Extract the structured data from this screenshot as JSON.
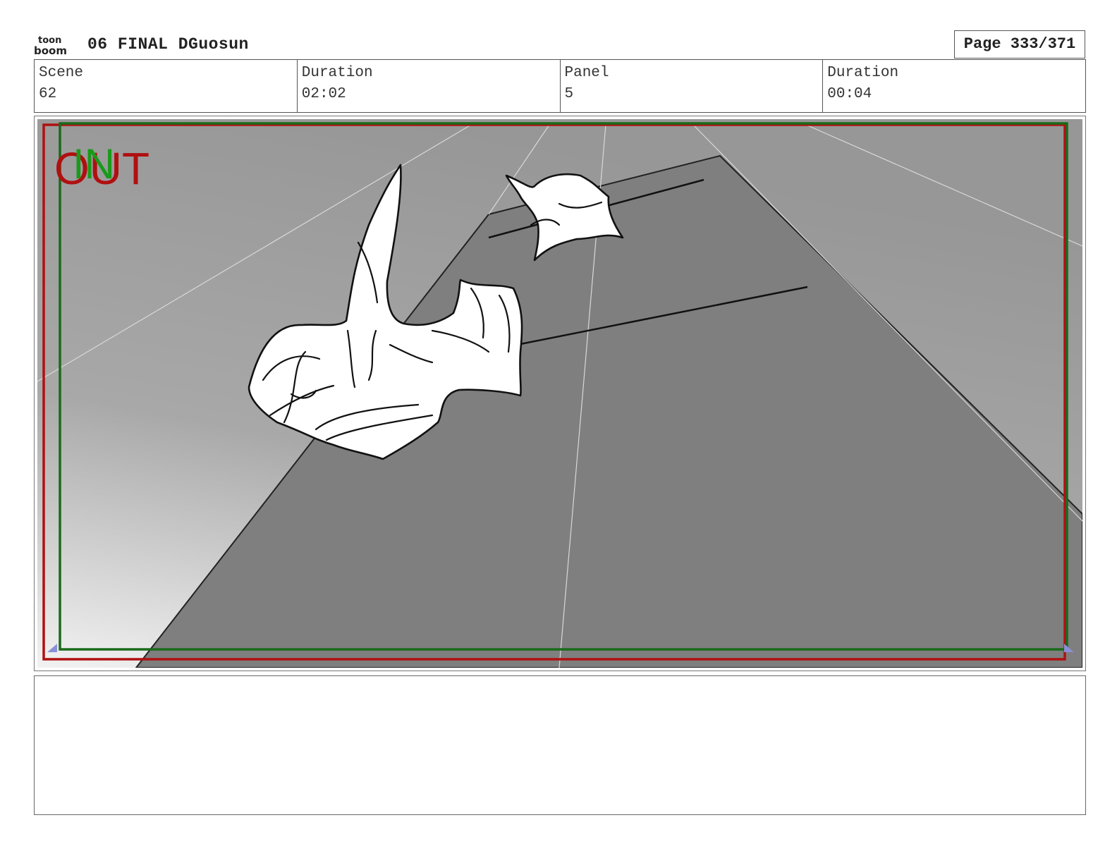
{
  "header": {
    "logo_text_top": "toon",
    "logo_text_bottom": "boom",
    "title": "06 FINAL DGuosun",
    "page_label": "Page 333/371"
  },
  "info": {
    "scene_label": "Scene",
    "scene_value": "62",
    "scene_duration_label": "Duration",
    "scene_duration_value": "02:02",
    "panel_label": "Panel",
    "panel_value": "5",
    "panel_duration_label": "Duration",
    "panel_duration_value": "00:04"
  },
  "panel": {
    "in_marker": "IN",
    "out_marker": "OUT",
    "in_color": "#1a9a1a",
    "out_color": "#b01010"
  },
  "notes": {
    "text": ""
  }
}
